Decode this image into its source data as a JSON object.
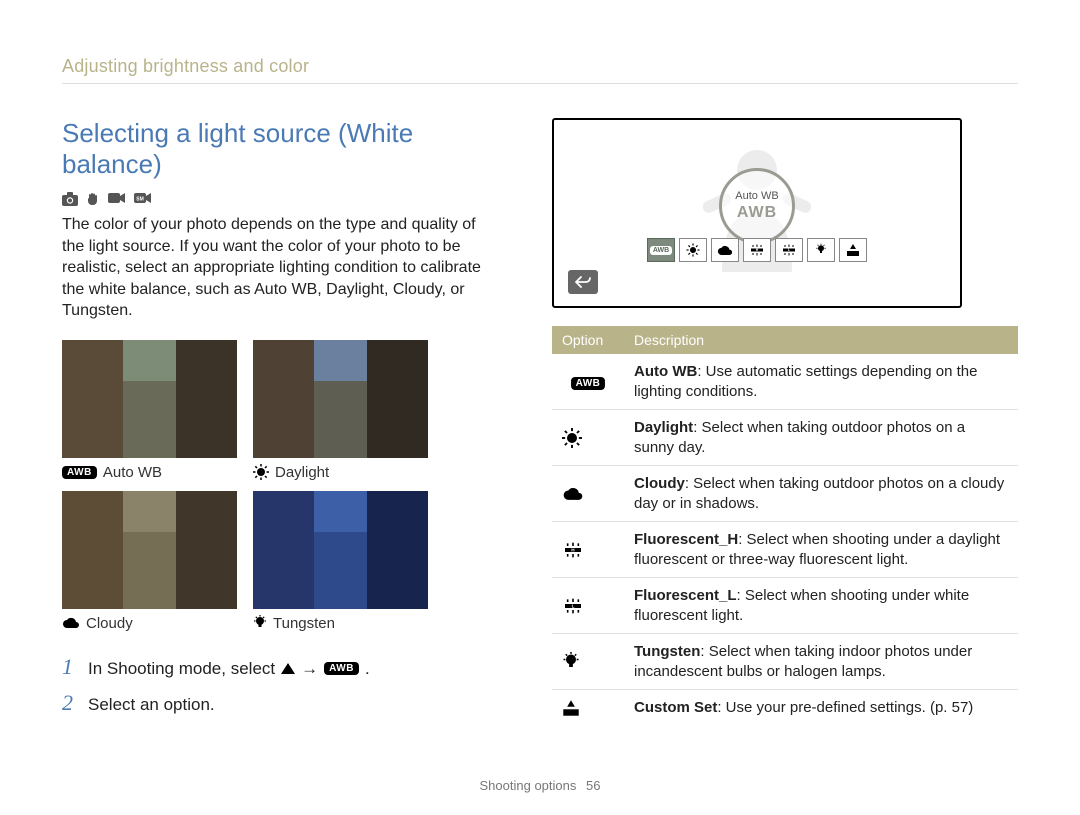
{
  "section_header": "Adjusting brightness and color",
  "title": "Selecting a light source (White balance)",
  "intro": "The color of your photo depends on the type and quality of the light source. If you want the color of your photo to be realistic, select an appropriate lighting condition to calibrate the white balance, such as Auto WB, Daylight, Cloudy, or Tungsten.",
  "thumbs": [
    {
      "label": "Auto WB",
      "icon": "awb"
    },
    {
      "label": "Daylight",
      "icon": "sun"
    },
    {
      "label": "Cloudy",
      "icon": "cloud"
    },
    {
      "label": "Tungsten",
      "icon": "bulb"
    }
  ],
  "thumb_tints": {
    "autowb": {
      "sky": "#7d8c76",
      "road": "#6a6a58",
      "bl": "#5a4b38",
      "br": "#3b3228"
    },
    "daylight": {
      "sky": "#6b7f9e",
      "road": "#5e5e52",
      "bl": "#4f4234",
      "br": "#302a22"
    },
    "cloudy": {
      "sky": "#8a836a",
      "road": "#766e54",
      "bl": "#5e4d36",
      "br": "#40362a"
    },
    "tungsten": {
      "sky": "#3d5fa8",
      "road": "#2f4a8a",
      "bl": "#26356a",
      "br": "#17244e"
    }
  },
  "steps": [
    {
      "num": "1",
      "text_pre": "In Shooting mode, select ",
      "text_post": "."
    },
    {
      "num": "2",
      "text": "Select an option."
    }
  ],
  "preview": {
    "selected_label": "Auto WB",
    "selected_big": "AWB",
    "row_icons": [
      "awb",
      "sun",
      "cloud",
      "fluoh",
      "fluol",
      "bulb",
      "custom"
    ]
  },
  "table": {
    "headers": [
      "Option",
      "Description"
    ],
    "rows": [
      {
        "icon": "awb",
        "name": "Auto WB",
        "desc": ": Use automatic settings depending on the lighting conditions."
      },
      {
        "icon": "sun",
        "name": "Daylight",
        "desc": ": Select when taking outdoor photos on a sunny day."
      },
      {
        "icon": "cloud",
        "name": "Cloudy",
        "desc": ": Select when taking outdoor photos on a cloudy day or in shadows."
      },
      {
        "icon": "fluoh",
        "name": "Fluorescent_H",
        "desc": ": Select when shooting under a daylight fluorescent or three-way fluorescent light."
      },
      {
        "icon": "fluol",
        "name": "Fluorescent_L",
        "desc": ": Select when shooting under white fluorescent light."
      },
      {
        "icon": "bulb",
        "name": "Tungsten",
        "desc": ": Select when taking indoor photos under incandescent bulbs or halogen lamps."
      },
      {
        "icon": "custom",
        "name": "Custom Set",
        "desc": ": Use your pre-defined settings. (p. 57)"
      }
    ]
  },
  "footer": {
    "section": "Shooting options",
    "page": "56"
  },
  "arrow": "→"
}
